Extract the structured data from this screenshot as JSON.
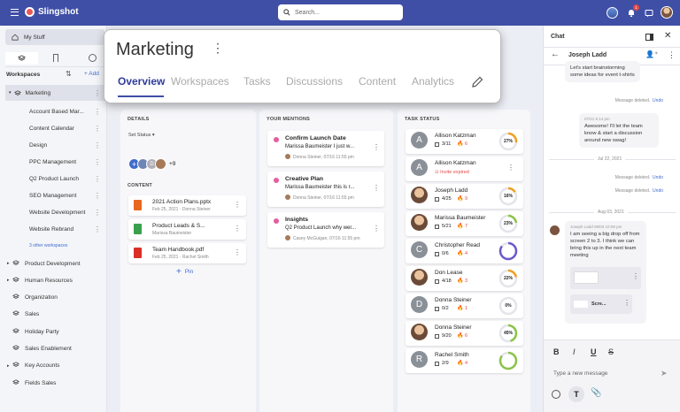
{
  "topbar": {
    "brand": "Slingshot",
    "search_placeholder": "Search...",
    "notif_badge": "1"
  },
  "sidebar": {
    "my_stuff": "My Stuff",
    "workspaces_label": "Workspaces",
    "add_label": "Add",
    "marketing": "Marketing",
    "sub_items": [
      "Account Based Mar...",
      "Content Calendar",
      "Design",
      "PPC Management",
      "Q2 Product Launch",
      "SEO Management",
      "Website Development",
      "Website Rebrand"
    ],
    "other_link": "3 other workspaces",
    "items": [
      "Product Development",
      "Human Resources",
      "Organization",
      "Sales",
      "Holiday Party",
      "Sales Enablement",
      "Key Accounts",
      "Fields Sales"
    ]
  },
  "overlay": {
    "title": "Marketing",
    "tabs": [
      "Overview",
      "Workspaces",
      "Tasks",
      "Discussions",
      "Content",
      "Analytics"
    ]
  },
  "details": {
    "header": "DETAILS",
    "set_status": "Set Status",
    "more_members": "+9",
    "content_header": "CONTENT",
    "pin": "Pin",
    "files": [
      {
        "name": "2021 Action Plans.pptx",
        "meta": "Feb 25, 2021 · Donna Steiner",
        "color": "#e8681f"
      },
      {
        "name": "Product Leads & S...",
        "meta": "Marissa Baumeister",
        "color": "#3aa04d"
      },
      {
        "name": "Team Handbook.pdf",
        "meta": "Feb 25, 2021 · Rachel Smith",
        "color": "#d93026"
      }
    ]
  },
  "mentions": {
    "header": "YOUR MENTIONS",
    "items": [
      {
        "title": "Confirm Launch Date",
        "text": "Marissa Baumeister I just w...",
        "meta": "Donna Steiner, 07/16 11:55 pm"
      },
      {
        "title": "Creative Plan",
        "text": "Marissa Baumeister this is r...",
        "meta": "Donna Steiner, 07/16 11:55 pm"
      },
      {
        "title": "Insights",
        "text": "Q2 Product Launch why wer...",
        "meta": "Casey McGuigan, 07/16 11:55 pm"
      }
    ]
  },
  "tasks": {
    "header": "TASK STATUS",
    "items": [
      {
        "name": "Allison Katzman",
        "tasks": "3/11",
        "fire": "6",
        "pct": "27%",
        "pct_value": 27,
        "initial": "A",
        "photo": false,
        "ring": "#f0a020",
        "expired": false
      },
      {
        "name": "Allison Katzman",
        "invite": "Invite expired",
        "initial": "A",
        "photo": false,
        "expired": true
      },
      {
        "name": "Joseph Ladd",
        "tasks": "4/25",
        "fire": "9",
        "pct": "16%",
        "pct_value": 16,
        "initial": "J",
        "photo": true,
        "ring": "#f0a020",
        "expired": false
      },
      {
        "name": "Marissa Baumeister",
        "tasks": "5/21",
        "fire": "7",
        "pct": "23%",
        "pct_value": 23,
        "initial": "M",
        "photo": true,
        "ring": "#8bc34a",
        "expired": false
      },
      {
        "name": "Christopher Read",
        "tasks": "0/6",
        "fire": "4",
        "pct": "",
        "pct_value": 0,
        "initial": "C",
        "photo": false,
        "ring": "#6a5acd",
        "expired": false
      },
      {
        "name": "Don Lease",
        "tasks": "4/18",
        "fire": "3",
        "pct": "22%",
        "pct_value": 22,
        "initial": "D",
        "photo": true,
        "ring": "#f0a020",
        "expired": false
      },
      {
        "name": "Donna Steiner",
        "tasks": "0/2",
        "fire": "1",
        "pct": "0%",
        "pct_value": 0,
        "initial": "D",
        "photo": false,
        "ring": "#ccc",
        "expired": false
      },
      {
        "name": "Donna Steiner",
        "tasks": "9/20",
        "fire": "6",
        "pct": "45%",
        "pct_value": 45,
        "initial": "D",
        "photo": true,
        "ring": "#8bc34a",
        "expired": false
      },
      {
        "name": "Rachel Smith",
        "tasks": "2/9",
        "fire": "4",
        "pct": "",
        "pct_value": 0,
        "initial": "R",
        "photo": false,
        "ring": "#8bc34a",
        "expired": false
      }
    ]
  },
  "chat": {
    "title": "Chat",
    "contact": "Joseph Ladd",
    "msg1": "Let's start brainstorming some ideas for event t-shirts",
    "deleted": "Message deleted.",
    "undo": "Undo",
    "msg2_time": "07/21 6:14 pm",
    "msg2": "Awesome! I'll let the team know & start a discussion around new swag!",
    "date1": "Jul 22, 2021",
    "date2": "Aug 03, 2021",
    "msg3_author": "Joseph Ladd",
    "msg3_time": "08/03 10:08 pm",
    "msg3": "I am seeing a big drop off from screen 2 to 3. I think we can bring this up in the next team meeting",
    "attach2": "Scre...",
    "input_placeholder": "Type a new message"
  },
  "colors": {
    "topbar": "#3f4fa6",
    "accent": "#3f4fa6",
    "active_tab": "#2f3d9a"
  }
}
